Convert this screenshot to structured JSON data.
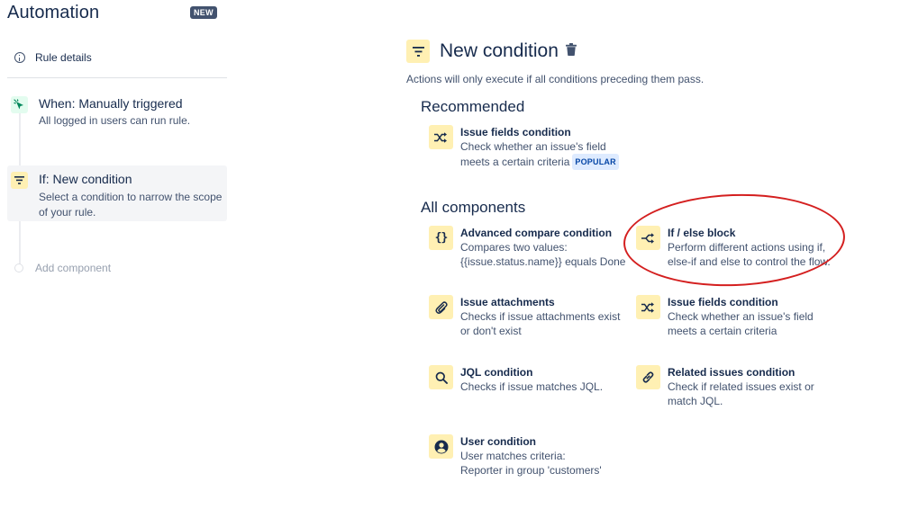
{
  "app": {
    "title": "Automation",
    "badge": "NEW"
  },
  "sidebar": {
    "rule_details": "Rule details",
    "steps": [
      {
        "title": "When: Manually triggered",
        "subtitle": "All logged in users can run rule."
      },
      {
        "title": "If: New condition",
        "subtitle_line1": "Select a condition to narrow the scope",
        "subtitle_line2": "of your rule."
      }
    ],
    "add_component": "Add component"
  },
  "main": {
    "title": "New condition",
    "subtitle": "Actions will only execute if all conditions preceding them pass.",
    "recommended_heading": "Recommended",
    "all_heading": "All components",
    "recommended": [
      {
        "title": "Issue fields condition",
        "desc_line1": "Check whether an issue's field",
        "desc_line2": "meets a certain criteria",
        "badge": "POPULAR",
        "icon": "shuffle-icon"
      }
    ],
    "components": [
      {
        "title": "Advanced compare condition",
        "desc_line1": "Compares two values:",
        "desc_line2": "{{issue.status.name}} equals Done",
        "icon": "braces-icon"
      },
      {
        "title": "If / else block",
        "desc_line1": "Perform different actions using if,",
        "desc_line2": "else-if and else to control the flow.",
        "icon": "branch-icon"
      },
      {
        "title": "Issue attachments",
        "desc_line1": "Checks if issue attachments exist",
        "desc_line2": "or don't exist",
        "icon": "paperclip-icon"
      },
      {
        "title": "Issue fields condition",
        "desc_line1": "Check whether an issue's field",
        "desc_line2": "meets a certain criteria",
        "icon": "shuffle-icon"
      },
      {
        "title": "JQL condition",
        "desc_line1": "Checks if issue matches JQL.",
        "desc_line2": "",
        "icon": "search-icon"
      },
      {
        "title": "Related issues condition",
        "desc_line1": "Check if related issues exist or",
        "desc_line2": "match JQL.",
        "icon": "link-icon"
      },
      {
        "title": "User condition",
        "desc_line1": "User matches criteria:",
        "desc_line2": "Reporter in group 'customers'",
        "icon": "user-icon"
      }
    ]
  },
  "colors": {
    "icon_bg": "#fff0b3",
    "annotation": "#d41f1f",
    "badge_bg": "#42526e",
    "popular_bg": "#deebff"
  }
}
